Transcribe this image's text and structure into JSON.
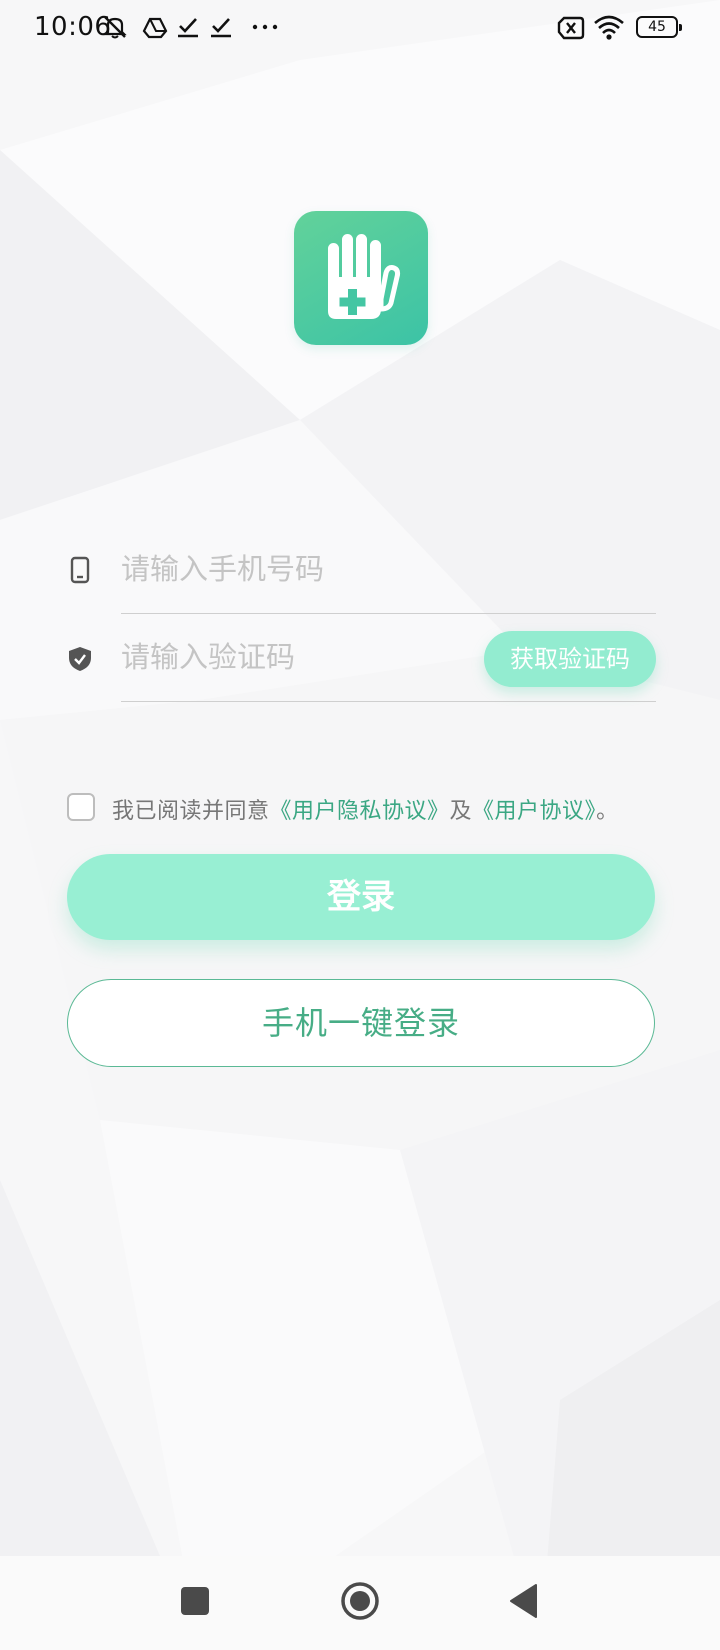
{
  "status_bar": {
    "time": "10:06",
    "battery": "45",
    "icons": [
      "muted-icon",
      "drive-icon",
      "check-icon",
      "check-icon",
      "more-dots-icon",
      "no-sim-icon",
      "wifi-icon",
      "battery-icon"
    ]
  },
  "logo": {
    "icon": "hand-medical-icon",
    "gradient": [
      "#62d29a",
      "#3cc3a6"
    ]
  },
  "phone": {
    "placeholder": "请输入手机号码",
    "value": "",
    "icon": "phone-icon"
  },
  "code": {
    "placeholder": "请输入验证码",
    "value": "",
    "icon": "shield-check-icon",
    "button_label": "获取验证码"
  },
  "agreement": {
    "prefix": "我已阅读并同意",
    "privacy_link": "《用户隐私协议》",
    "joiner": "及",
    "user_link": "《用户协议》",
    "suffix": "。",
    "checked": false
  },
  "buttons": {
    "login": "登录",
    "quick_login": "手机一键登录"
  },
  "nav": {
    "icons": [
      "recents-square-icon",
      "home-circle-icon",
      "back-triangle-icon"
    ]
  },
  "colors": {
    "accent": "#3ba783",
    "button_light": "#98efd3",
    "outline": "#5bb995"
  }
}
